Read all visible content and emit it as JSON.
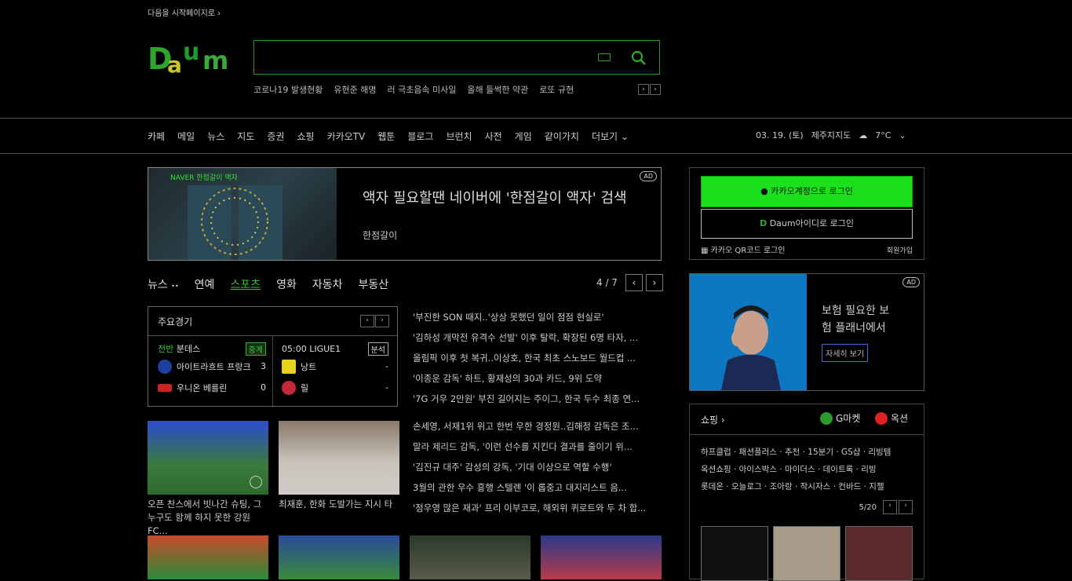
{
  "topbar": {
    "start_page": "다음을 시작페이지로 ›"
  },
  "logo": {
    "alt": "Daum"
  },
  "search": {
    "placeholder": ""
  },
  "keywords": [
    "코로나19 발생현황",
    "유현준 해명",
    "러 극초음속 미사일",
    "올해 들썩한 약관",
    "로또 규현"
  ],
  "gnb": {
    "items": [
      "카페",
      "메일",
      "뉴스",
      "지도",
      "증권",
      "쇼핑",
      "카카오TV",
      "웹툰",
      "블로그",
      "브런치",
      "사전",
      "게임",
      "같이가치",
      "더보기"
    ],
    "date": "03. 19. (토)",
    "location": "제주지지도",
    "temp": "7°C"
  },
  "ad_banner": {
    "badge": "AD",
    "title": "액자 필요할땐 네이버에 '한점갈이 액자' 검색",
    "subtitle": "한점갈이",
    "label": "NAVER 한점갈이 액자"
  },
  "news_tabs": {
    "tabs": [
      "뉴스",
      "연예",
      "스포츠",
      "영화",
      "자동차",
      "부동산"
    ],
    "active": "스포츠",
    "page": "4 / 7"
  },
  "scoreboard": {
    "title": "주요경기",
    "game1": {
      "status": "전반",
      "league": "분데스",
      "badge": "중계",
      "home": "아이트라흐트 프랑크",
      "home_score": "3",
      "away": "우니온 베를린",
      "away_score": "0"
    },
    "game2": {
      "time": "05:00",
      "league": "LIGUE1",
      "badge": "분석",
      "home": "낭트",
      "home_score": "-",
      "away": "릴",
      "away_score": "-"
    }
  },
  "headlines": [
    "'부진한 SON 때지..'상상 못했던 일이 점점 현실로'",
    "'김하성 개막전 유격수 선발' 이후 탈락, 확장된 6명 타자, ...",
    "올림픽 이후 첫 복귀..이상호, 한국 최초 스노보드 월드컵 ...",
    "'이종운 감독' 하트, 황재성의 30과 카드, 9위 도약",
    "'7G 거우 2만원' 부진 길어지는 주이그, 한국 두수 최종 연..."
  ],
  "thumbs": [
    {
      "caption": "오픈 찬스에서 빗나간 슈팅, 그 누구도 함께 하지 못한 강원 FC..."
    },
    {
      "caption": "최재훈, 한화 도발가는 지시 타"
    }
  ],
  "headlines2": [
    "손세영, 서재1위 위고 한번 우한 경정원..김해정 감독은 조...",
    "말라 제리드 감독, '이런 선수를 지킨다 결과를 줄이기 위...",
    "'김진규 대주' 감성의 강독, '기대 이상으로 역할 수행'",
    "3월의 관한 우수 흥행 스텔렌 '이 롭중고 대지리스트 음...",
    "'정우영 많은 재과' 프리 이부코로, 해외위 퀴로트와 두 차 합..."
  ],
  "login": {
    "kakao_label": "카카오계정으로 로그인",
    "daum_label": "Daum아이디로 로그인",
    "qr_label": "카카오 QR코드 로그인",
    "join_label": "회원가입"
  },
  "ad2": {
    "badge": "AD",
    "line1": "보험 필요한 보",
    "line2": "험 플래너에서",
    "button": "자세히 보기"
  },
  "shopping": {
    "title": "쇼핑 ›",
    "gmarket": "G마켓",
    "auction": "옥션",
    "links": [
      "하프클럽 · 패션플러스 · 추천 · 15분기 · GS샵 · 리빙템",
      "옥션쇼핑 · 아이스박스 · 마이더스 · 데이트록 · 리빙",
      "롯데온 · 오늘로그 · 조아랑 · 작시자스 · 컨바드 · 지젤"
    ],
    "page": "5/20"
  },
  "colors": {
    "accent": "#1be01b",
    "search_border": "#1e9d1e",
    "bg": "#000000"
  }
}
